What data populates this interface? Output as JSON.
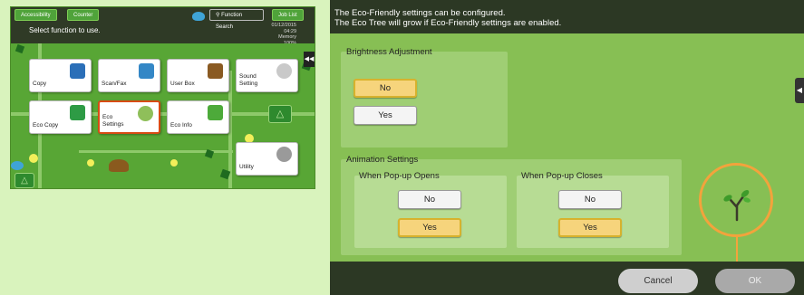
{
  "home": {
    "tabs": {
      "accessibility": "Accessibility",
      "counter": "Counter",
      "function_search": "Function Search",
      "job_list": "Job List"
    },
    "message": "Select function to use.",
    "date": "01/12/2015",
    "time": "04:29",
    "memory_label": "Memory",
    "memory_value": "100%",
    "tiles": {
      "copy": "Copy",
      "scan_fax": "Scan/Fax",
      "user_box": "User Box",
      "sound_setting_line1": "Sound",
      "sound_setting_line2": "Setting",
      "eco_copy": "Eco Copy",
      "eco_settings_line1": "Eco",
      "eco_settings_line2": "Settings",
      "eco_info": "Eco Info",
      "utility": "Utility"
    }
  },
  "eco": {
    "header_line1": "The Eco-Friendly settings can be configured.",
    "header_line2": "The Eco Tree will grow if Eco-Friendly settings are enabled.",
    "brightness": {
      "title": "Brightness Adjustment",
      "no": "No",
      "yes": "Yes",
      "selected": "No"
    },
    "animation": {
      "title": "Animation Settings",
      "popup_opens": {
        "title": "When Pop-up Opens",
        "no": "No",
        "yes": "Yes",
        "selected": "Yes"
      },
      "popup_closes": {
        "title": "When Pop-up Closes",
        "no": "No",
        "yes": "Yes",
        "selected": "Yes"
      }
    },
    "cancel": "Cancel",
    "ok": "OK"
  },
  "colors": {
    "accent_selected": "#f6d47c",
    "tree_ring": "#f3a33c",
    "panel_green": "#87bf54",
    "header_dark": "#2c3824"
  }
}
